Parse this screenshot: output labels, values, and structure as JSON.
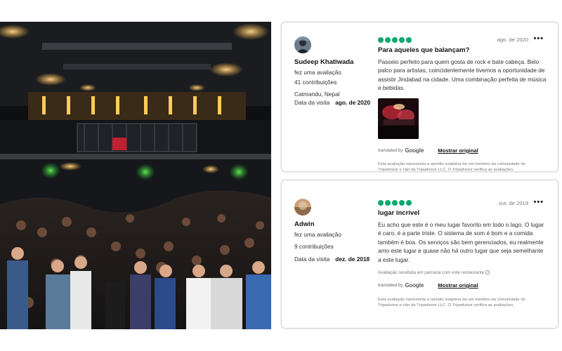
{
  "photo": {
    "alt": ""
  },
  "reviews": [
    {
      "user": {
        "name": "Sudeep Khatiwada",
        "action": "fez uma avaliação",
        "contributions": "41 contribuições",
        "location": "Catmandu, Nepal"
      },
      "visit_label": "Data da visita",
      "visit_date": "ago. de 2020",
      "rating": 5,
      "review_date": "ago. de 2020",
      "title": "Para aqueles que balançam?",
      "text": "Passeio perfeito para quem gosta de rock e bate cabeça. Belo palco para artistas, coincidentemente tivemos a oportunidade de assistir Jindabad na cidade. Uma combinação perfeita de música e bebidas.",
      "translated_by": "translated by",
      "translated_provider": "Google",
      "show_original": "Mostrar original",
      "disclaimer": "Esta avaliação representa a opinião subjetiva de um membro da comunidade do Tripadvisor e não da Tripadvisor LLC. O Tripadvisor verifica as avaliações."
    },
    {
      "user": {
        "name": "Adwin",
        "action": "fez uma avaliação",
        "contributions": "9 contribuições",
        "location": ""
      },
      "visit_label": "Data da visita",
      "visit_date": "dez. de 2018",
      "rating": 5,
      "review_date": "out. de 2019",
      "title": "lugar incrível",
      "text": "Eu acho que este é o meu lugar favorito em todo o lago. O lugar é caro, é a parte triste. O sistema de som é bom e a comida também é boa. Os serviços são bem gerenciados, eu realmente amo este lugar e quase não há outro lugar que seja semelhante a este lugar.",
      "partner_note": "Avaliação recebida em parceria com este restaurante",
      "translated_by": "translated by",
      "translated_provider": "Google",
      "show_original": "Mostrar original",
      "disclaimer": "Esta avaliação representa a opinião subjetiva de um membro da comunidade do Tripadvisor e não da Tripadvisor LLC. O Tripadvisor verifica as avaliações."
    }
  ],
  "colors": {
    "star": "#00aa6c",
    "card_border": "#d9d9d9"
  },
  "icons": {
    "more": "more-options-icon",
    "info": "info-icon"
  }
}
